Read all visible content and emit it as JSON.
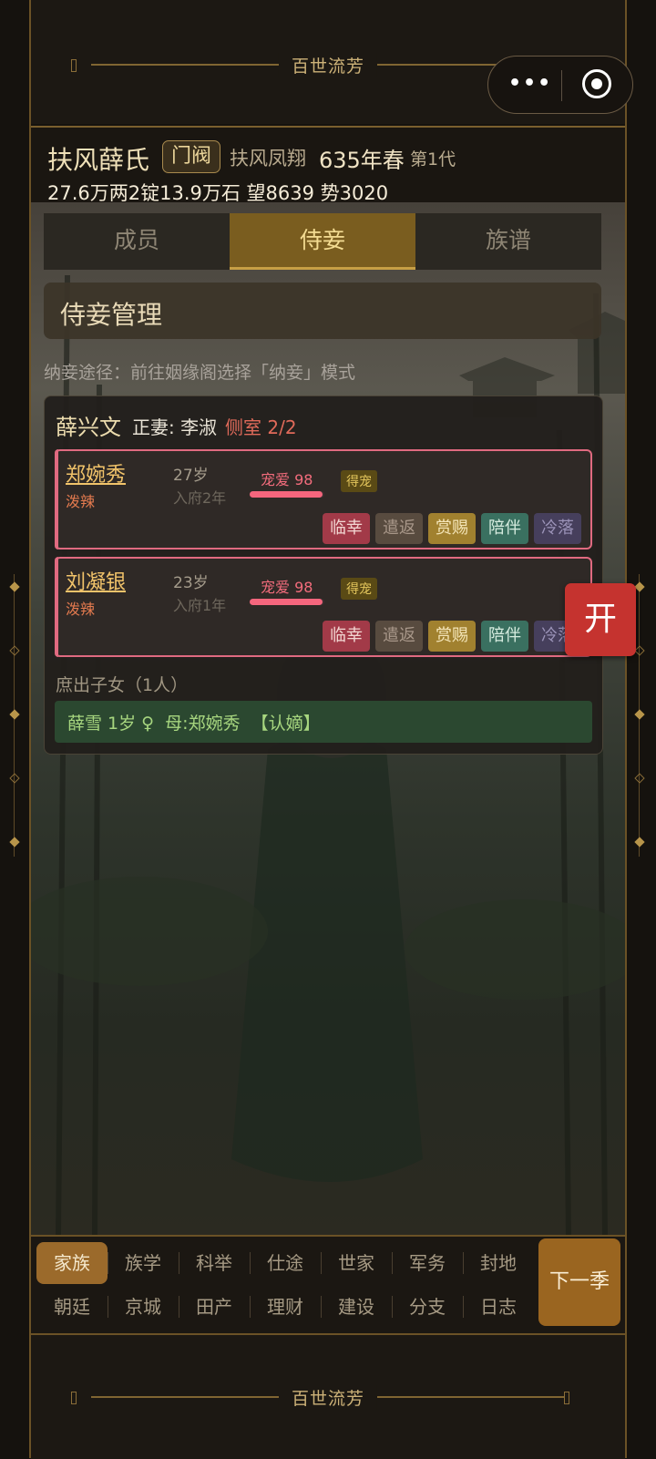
{
  "top_banner": {
    "title": "百世流芳"
  },
  "bottom_banner": {
    "title": "百世流芳"
  },
  "mini_program": {
    "more_label": "•••"
  },
  "header": {
    "clan_name": "扶风薛氏",
    "rank_badge": "门阀",
    "location": "扶风凤翔",
    "year": "635年春",
    "generation": "第1代",
    "stats": "27.6万两2锭13.9万石 望8639 势3020"
  },
  "tabs": [
    {
      "label": "成员",
      "active": false
    },
    {
      "label": "侍妾",
      "active": true
    },
    {
      "label": "族谱",
      "active": false
    }
  ],
  "section": {
    "title": "侍妾管理",
    "hint": "纳妾途径：前往姻缘阁选择「纳妾」模式"
  },
  "household": {
    "owner": "薛兴文",
    "wife": "正妻: 李淑",
    "side_count": "侧室 2/2",
    "concubines": [
      {
        "name": "郑婉秀",
        "trait": "泼辣",
        "age": "27岁",
        "years": "入府2年",
        "favor": "宠爱 98",
        "favor_value": 98,
        "tag": "得宠",
        "actions": [
          "临幸",
          "遣返",
          "赏赐",
          "陪伴",
          "冷落"
        ]
      },
      {
        "name": "刘凝银",
        "trait": "泼辣",
        "age": "23岁",
        "years": "入府1年",
        "favor": "宠爱 98",
        "favor_value": 98,
        "tag": "得宠",
        "actions": [
          "临幸",
          "遣返",
          "赏赐",
          "陪伴",
          "冷落"
        ]
      }
    ],
    "children_title": "庶出子女（1人）",
    "children": [
      {
        "text": "薛雪 1岁 ♀  母:郑婉秀  【认嫡】"
      }
    ]
  },
  "floating_button": "开",
  "bottom_nav": {
    "row1": [
      "家族",
      "族学",
      "科举",
      "仕途",
      "世家",
      "军务",
      "封地"
    ],
    "row2": [
      "朝廷",
      "京城",
      "田产",
      "理财",
      "建设",
      "分支",
      "日志"
    ],
    "active": "家族",
    "next_button": "下一季"
  },
  "colors": {
    "accent_gold": "#c79f45",
    "favor_pink": "#f5667d",
    "open_red": "#c5332f"
  }
}
